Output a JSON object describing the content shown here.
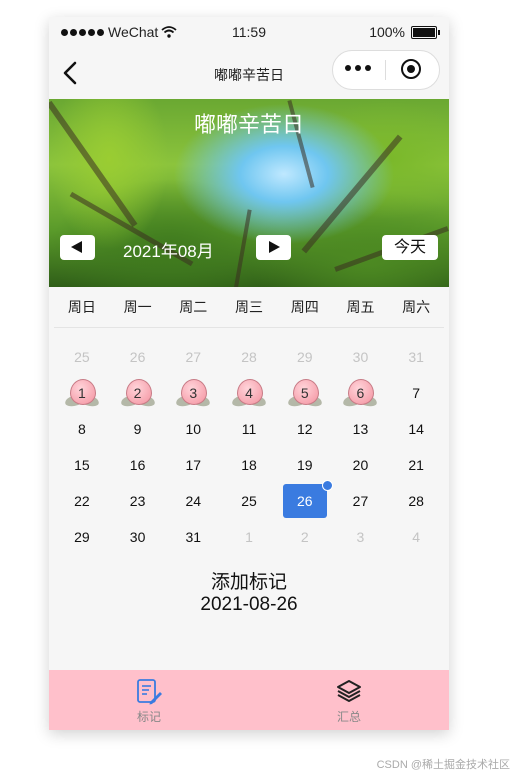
{
  "status_bar": {
    "carrier": "WeChat",
    "time": "11:59",
    "battery": "100%"
  },
  "nav": {
    "title": "嘟嘟辛苦日"
  },
  "banner": {
    "heading": "嘟嘟辛苦日",
    "month": "2021年08月",
    "today_label": "今天"
  },
  "weekdays": [
    "周日",
    "周一",
    "周二",
    "周三",
    "周四",
    "周五",
    "周六"
  ],
  "calendar": {
    "weeks": [
      [
        {
          "d": "25",
          "state": "dim"
        },
        {
          "d": "26",
          "state": "dim"
        },
        {
          "d": "27",
          "state": "dim"
        },
        {
          "d": "28",
          "state": "dim"
        },
        {
          "d": "29",
          "state": "dim"
        },
        {
          "d": "30",
          "state": "dim"
        },
        {
          "d": "31",
          "state": "dim"
        }
      ],
      [
        {
          "d": "1",
          "state": "marked"
        },
        {
          "d": "2",
          "state": "marked"
        },
        {
          "d": "3",
          "state": "marked"
        },
        {
          "d": "4",
          "state": "marked"
        },
        {
          "d": "5",
          "state": "marked"
        },
        {
          "d": "6",
          "state": "marked"
        },
        {
          "d": "7",
          "state": "normal"
        }
      ],
      [
        {
          "d": "8",
          "state": "normal"
        },
        {
          "d": "9",
          "state": "normal"
        },
        {
          "d": "10",
          "state": "normal"
        },
        {
          "d": "11",
          "state": "normal"
        },
        {
          "d": "12",
          "state": "normal"
        },
        {
          "d": "13",
          "state": "normal"
        },
        {
          "d": "14",
          "state": "normal"
        }
      ],
      [
        {
          "d": "15",
          "state": "normal"
        },
        {
          "d": "16",
          "state": "normal"
        },
        {
          "d": "17",
          "state": "normal"
        },
        {
          "d": "18",
          "state": "normal"
        },
        {
          "d": "19",
          "state": "normal"
        },
        {
          "d": "20",
          "state": "normal"
        },
        {
          "d": "21",
          "state": "normal"
        }
      ],
      [
        {
          "d": "22",
          "state": "normal"
        },
        {
          "d": "23",
          "state": "normal"
        },
        {
          "d": "24",
          "state": "normal"
        },
        {
          "d": "25",
          "state": "normal"
        },
        {
          "d": "26",
          "state": "selected"
        },
        {
          "d": "27",
          "state": "normal"
        },
        {
          "d": "28",
          "state": "normal"
        }
      ],
      [
        {
          "d": "29",
          "state": "normal"
        },
        {
          "d": "30",
          "state": "normal"
        },
        {
          "d": "31",
          "state": "normal"
        },
        {
          "d": "1",
          "state": "dim"
        },
        {
          "d": "2",
          "state": "dim"
        },
        {
          "d": "3",
          "state": "dim"
        },
        {
          "d": "4",
          "state": "dim"
        }
      ]
    ]
  },
  "mark": {
    "add_label": "添加标记",
    "date": "2021-08-26"
  },
  "tabs": [
    {
      "label": "标记",
      "icon": "edit-document-icon"
    },
    {
      "label": "汇总",
      "icon": "layers-icon"
    }
  ],
  "watermark": "CSDN @稀土掘金技术社区",
  "colors": {
    "accent": "#3a7be0",
    "tabbar": "#ffc0cb",
    "marker": "#f7a6b1"
  }
}
